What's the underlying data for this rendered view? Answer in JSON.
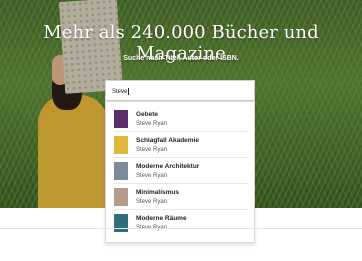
{
  "hero": {
    "title": "Mehr als 240.000 Bücher und Magazine",
    "subtitle": "Suche nach Titel, Autor oder ISBN."
  },
  "search": {
    "value": "Steve"
  },
  "results": [
    {
      "title": "Gebete",
      "author": "Steve Ryan",
      "cover_color": "#5a2d6b"
    },
    {
      "title": "Schlagfall Akademie",
      "author": "Steve Ryan",
      "cover_color": "#e0b93a"
    },
    {
      "title": "Moderne Architektur",
      "author": "Steve Ryan",
      "cover_color": "#7a8a99"
    },
    {
      "title": "Minimalismus",
      "author": "Steve Ryan",
      "cover_color": "#b69a8a"
    },
    {
      "title": "Moderne Räume",
      "author": "Steve Ryan",
      "cover_color": "#2f6f7a"
    }
  ]
}
